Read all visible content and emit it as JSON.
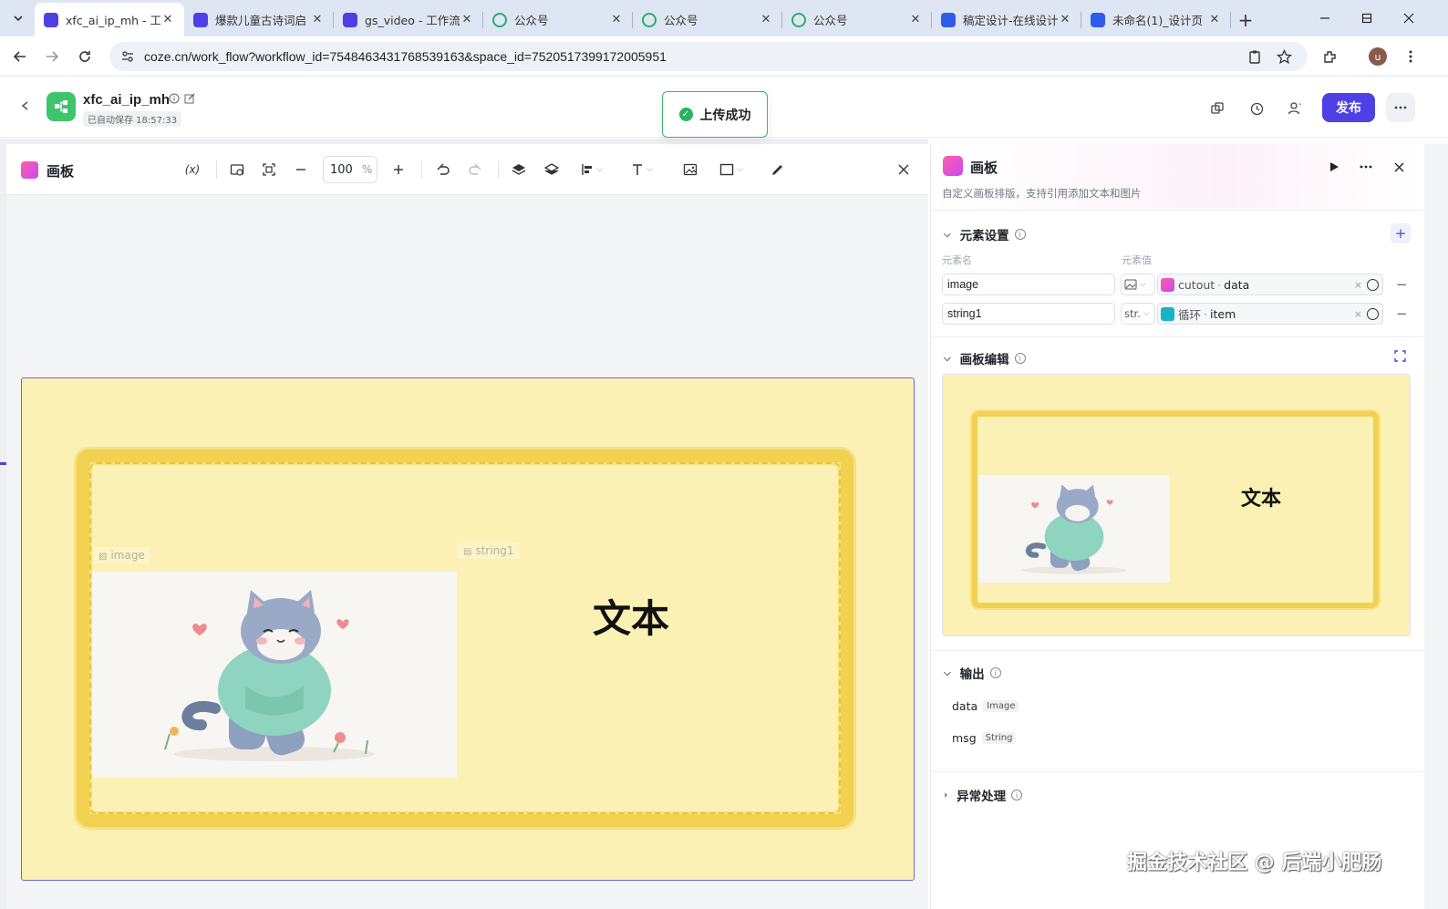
{
  "browser": {
    "tabs": [
      {
        "title": "xfc_ai_ip_mh - 工",
        "active": true,
        "icon": "coze-icon"
      },
      {
        "title": "爆款儿童古诗词启",
        "active": false,
        "icon": "coze-icon"
      },
      {
        "title": "gs_video - 工作流",
        "active": false,
        "icon": "coze-icon"
      },
      {
        "title": "公众号",
        "active": false,
        "icon": "wechat-mp-icon"
      },
      {
        "title": "公众号",
        "active": false,
        "icon": "wechat-mp-icon"
      },
      {
        "title": "公众号",
        "active": false,
        "icon": "wechat-mp-icon"
      },
      {
        "title": "稿定设计-在线设计",
        "active": false,
        "icon": "gaoding-icon"
      },
      {
        "title": "未命名(1)_设计页",
        "active": false,
        "icon": "gaoding-icon"
      }
    ],
    "url": "coze.cn/work_flow?workflow_id=7548463431768539163&space_id=7520517399172005951",
    "profile_initial": "u"
  },
  "app": {
    "name": "xfc_ai_ip_mh",
    "autosave": "已自动保存 18:57:33",
    "toast": "上传成功",
    "publish_label": "发布"
  },
  "editor": {
    "title": "画板",
    "variable_btn": "(x)",
    "zoom": "100",
    "zoom_unit": "%",
    "labels": {
      "image": "image",
      "string": "string1"
    },
    "canvas_text": "文本"
  },
  "panel": {
    "title": "画板",
    "description": "自定义画板排版，支持引用添加文本和图片",
    "elements_section": "元素设置",
    "col_name": "元素名",
    "col_value": "元素值",
    "rows": [
      {
        "name": "image",
        "type": "",
        "source": "cutout",
        "field": "data"
      },
      {
        "name": "string1",
        "type": "str.",
        "source": "循环",
        "field": "item"
      }
    ],
    "canvas_section": "画板编辑",
    "preview_text": "文本",
    "output_section": "输出",
    "outputs": [
      {
        "name": "data",
        "type": "Image"
      },
      {
        "name": "msg",
        "type": "String"
      }
    ],
    "error_section": "异常处理"
  },
  "watermark": "掘金技术社区 @ 后端小肥肠",
  "colors": {
    "accent": "#4e40e5",
    "success": "#27b35f",
    "board": "#fbf1b5",
    "frame": "#f0d250"
  }
}
